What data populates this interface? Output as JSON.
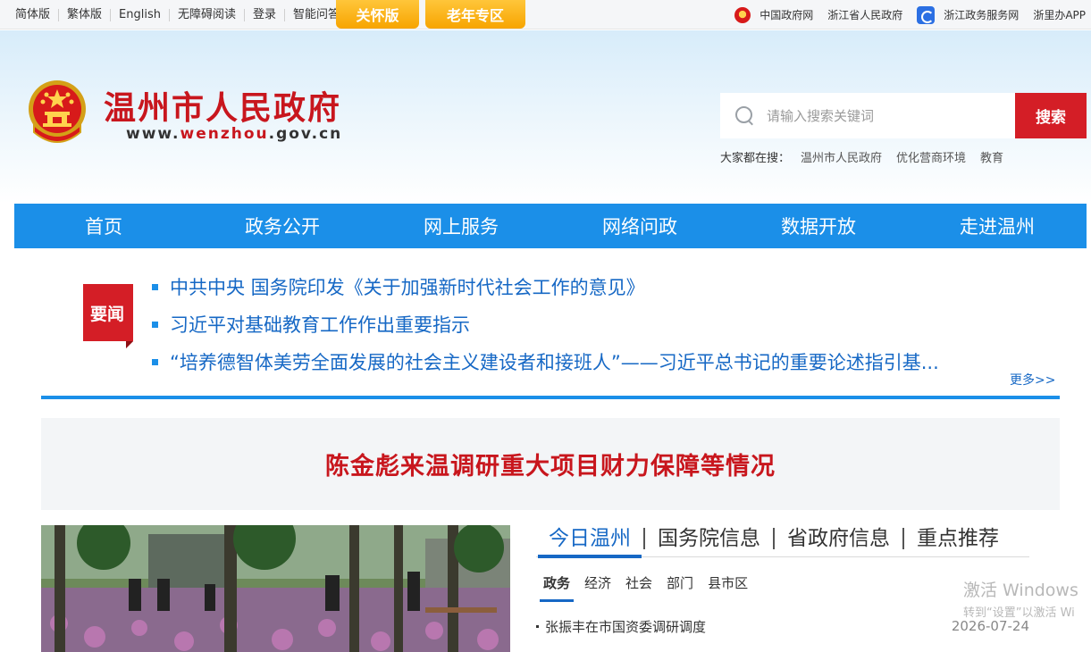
{
  "topbar": {
    "links": [
      "简体版",
      "繁体版",
      "English",
      "无障碍阅读",
      "登录",
      "智能问答"
    ],
    "care_label": "关怀版",
    "elderly_label": "老年专区",
    "right_links": [
      {
        "icon": "national-emblem-icon",
        "label": "中国政府网"
      },
      {
        "icon": "",
        "label": "浙江省人民政府"
      },
      {
        "icon": "zhejiang-service-icon",
        "label": "浙江政务服务网"
      },
      {
        "icon": "",
        "label": "浙里办APP"
      }
    ]
  },
  "header": {
    "site_name": "温州市人民政府",
    "url_prefix": "www.",
    "url_domain": "wenzhou",
    "url_suffix": ".gov.cn",
    "search_placeholder": "请输入搜索关键词",
    "search_button": "搜索",
    "hot_label": "大家都在搜：",
    "hot_items": [
      "温州市人民政府",
      "优化营商环境",
      "教育"
    ]
  },
  "nav": [
    "首页",
    "政务公开",
    "网上服务",
    "网络问政",
    "数据开放",
    "走进温州"
  ],
  "news": {
    "badge": "要闻",
    "headlines": [
      "中共中央 国务院印发《关于加强新时代社会工作的意见》",
      "习近平对基础教育工作作出重要指示",
      "“培养德智体美劳全面发展的社会主义建设者和接班人”——习近平总书记的重要论述指引基..."
    ],
    "more": "更多>>"
  },
  "banner_title": "陈金彪来温调研重大项目财力保障等情况",
  "tabs": [
    "今日温州",
    "国务院信息",
    "省政府信息",
    "重点推荐"
  ],
  "subtabs": [
    "政务",
    "经济",
    "社会",
    "部门",
    "县市区"
  ],
  "news_item": {
    "title": "张振丰在市国资委调研调度",
    "date": "2026-07-24"
  },
  "watermark": {
    "line1": "激活 Windows",
    "line2": "转到“设置”以激活 Wi"
  },
  "colors": {
    "brand_red": "#c8161d",
    "nav_blue": "#1b8fe8",
    "link_blue": "#1668c5",
    "care_yellow": "#f7a400"
  }
}
